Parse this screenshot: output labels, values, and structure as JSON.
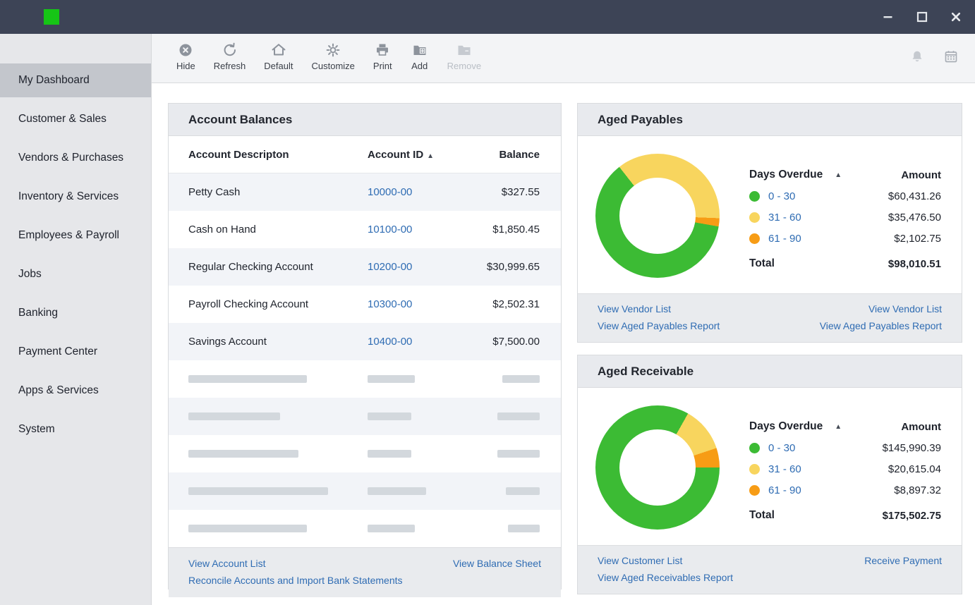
{
  "window": {
    "bar_color": "#3d4456",
    "logo_color": "#16c516",
    "controls": [
      "minimize",
      "maximize",
      "close"
    ]
  },
  "toolbar": {
    "buttons": [
      {
        "id": "hide",
        "label": "Hide",
        "icon": "hide-circle-x-icon",
        "disabled": false
      },
      {
        "id": "refresh",
        "label": "Refresh",
        "icon": "refresh-icon",
        "disabled": false
      },
      {
        "id": "default",
        "label": "Default",
        "icon": "home-icon",
        "disabled": false
      },
      {
        "id": "customize",
        "label": "Customize",
        "icon": "gear-icon",
        "disabled": false
      },
      {
        "id": "print",
        "label": "Print",
        "icon": "printer-icon",
        "disabled": false
      },
      {
        "id": "add",
        "label": "Add",
        "icon": "folder-plus-icon",
        "disabled": false
      },
      {
        "id": "remove",
        "label": "Remove",
        "icon": "folder-icon",
        "disabled": true
      }
    ],
    "right_icons": [
      "bell-icon",
      "calendar-icon"
    ]
  },
  "sidebar": {
    "items": [
      {
        "label": "My Dashboard",
        "selected": true
      },
      {
        "label": "Customer & Sales",
        "selected": false
      },
      {
        "label": "Vendors & Purchases",
        "selected": false
      },
      {
        "label": "Inventory & Services",
        "selected": false
      },
      {
        "label": "Employees & Payroll",
        "selected": false
      },
      {
        "label": "Jobs",
        "selected": false
      },
      {
        "label": "Banking",
        "selected": false
      },
      {
        "label": "Payment Center",
        "selected": false
      },
      {
        "label": "Apps & Services",
        "selected": false
      },
      {
        "label": "System",
        "selected": false
      }
    ]
  },
  "panels": {
    "account_balances": {
      "title": "Account Balances",
      "columns": [
        "Account Descripton",
        "Account ID",
        "Balance"
      ],
      "sort_arrow": "▲",
      "rows": [
        {
          "description": "Petty Cash",
          "account_id": "10000-00",
          "balance": "$327.55"
        },
        {
          "description": "Cash on Hand",
          "account_id": "10100-00",
          "balance": "$1,850.45"
        },
        {
          "description": "Regular Checking Account",
          "account_id": "10200-00",
          "balance": "$30,999.65"
        },
        {
          "description": "Payroll Checking Account",
          "account_id": "10300-00",
          "balance": "$2,502.31"
        },
        {
          "description": "Savings Account",
          "account_id": "10400-00",
          "balance": "$7,500.00"
        }
      ],
      "skeleton_rows": [
        {
          "desc_w": 168,
          "id_w": 67,
          "bal_w": 53
        },
        {
          "desc_w": 130,
          "id_w": 62,
          "bal_w": 60
        },
        {
          "desc_w": 156,
          "id_w": 62,
          "bal_w": 60
        },
        {
          "desc_w": 198,
          "id_w": 83,
          "bal_w": 48
        },
        {
          "desc_w": 168,
          "id_w": 67,
          "bal_w": 45
        }
      ],
      "links_left": [
        "View Account List",
        "Reconcile Accounts and Import Bank Statements"
      ],
      "links_right": [
        "View Balance Sheet"
      ]
    },
    "aged_payables": {
      "title": "Aged Payables",
      "legend_header": {
        "label": "Days Overdue",
        "sort_arrow": "▲",
        "amount": "Amount"
      },
      "legend_rows": [
        {
          "label": "0 - 30",
          "amount": "$60,431.26",
          "color": "#3cbb34"
        },
        {
          "label": "31 - 60",
          "amount": "$35,476.50",
          "color": "#f8d55e"
        },
        {
          "label": "61 - 90",
          "amount": "$2,102.75",
          "color": "#f79c15"
        }
      ],
      "total_label": "Total",
      "total_amount": "$98,010.51",
      "links_left": [
        "View Vendor List",
        "View Aged Payables Report"
      ],
      "links_right": [
        "View Vendor List",
        "View Aged Payables Report"
      ]
    },
    "aged_receivable": {
      "title": "Aged Receivable",
      "legend_header": {
        "label": "Days Overdue",
        "sort_arrow": "▲",
        "amount": "Amount"
      },
      "legend_rows": [
        {
          "label": "0 - 30",
          "amount": "$145,990.39",
          "color": "#3cbb34"
        },
        {
          "label": "31 - 60",
          "amount": "$20,615.04",
          "color": "#f8d55e"
        },
        {
          "label": "61 - 90",
          "amount": "$8,897.32",
          "color": "#f79c15"
        }
      ],
      "total_label": "Total",
      "total_amount": "$175,502.75",
      "links_left": [
        "View Customer List",
        "View Aged Receivables Report"
      ],
      "links_right": [
        "Receive Payment"
      ]
    }
  },
  "chart_data": [
    {
      "type": "pie",
      "variant": "donut",
      "title": "Aged Payables",
      "categories": [
        "0 - 30",
        "31 - 60",
        "61 - 90"
      ],
      "values": [
        60431.26,
        35476.5,
        2102.75
      ],
      "total": 98010.51,
      "colors": [
        "#3cbb34",
        "#f8d55e",
        "#f79c15"
      ],
      "start_angle_deg": 100,
      "legend_position": "right"
    },
    {
      "type": "pie",
      "variant": "donut",
      "title": "Aged Receivable",
      "categories": [
        "0 - 30",
        "31 - 60",
        "61 - 90"
      ],
      "values": [
        145990.39,
        20615.04,
        8897.32
      ],
      "total": 175502.75,
      "colors": [
        "#3cbb34",
        "#f8d55e",
        "#f79c15"
      ],
      "start_angle_deg": 90,
      "legend_position": "right"
    }
  ]
}
